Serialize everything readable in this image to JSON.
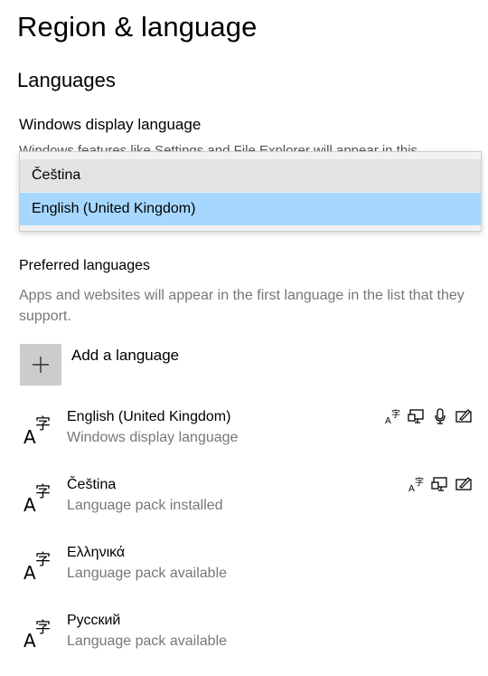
{
  "page": {
    "title": "Region & language"
  },
  "languages_section": {
    "title": "Languages",
    "display_language_label": "Windows display language",
    "display_language_description_clipped": "Windows features like Settings and File Explorer will appear in this",
    "dropdown": {
      "options": [
        "Čeština",
        "English (United Kingdom)"
      ],
      "selected": "English (United Kingdom)"
    }
  },
  "preferred": {
    "label": "Preferred languages",
    "description": "Apps and websites will appear in the first language in the list that they support.",
    "add_label": "Add a language",
    "add_icon": "plus-icon",
    "items": [
      {
        "name": "English (United Kingdom)",
        "status": "Windows display language",
        "features": [
          "language-pack-icon",
          "display-language-icon",
          "speech-icon",
          "handwriting-icon"
        ]
      },
      {
        "name": "Čeština",
        "status": "Language pack installed",
        "features": [
          "language-pack-icon",
          "display-language-icon",
          "handwriting-icon"
        ]
      },
      {
        "name": "Ελληνικά",
        "status": "Language pack available",
        "features": []
      },
      {
        "name": "Русский",
        "status": "Language pack available",
        "features": []
      }
    ]
  },
  "colors": {
    "selected_option_bg": "#a6d8ff",
    "hover_option_bg": "#e3e3e3",
    "add_tile_bg": "#cccccc",
    "secondary_text": "#777777"
  }
}
